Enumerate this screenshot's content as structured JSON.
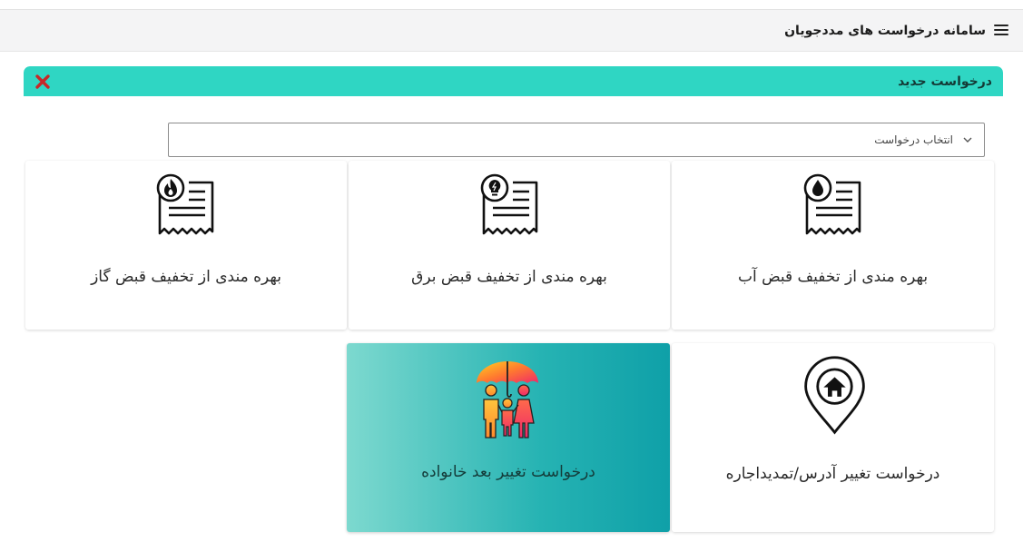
{
  "header": {
    "title": "سامانه درخواست های مددجویان",
    "menu_icon": "hamburger-menu-icon"
  },
  "panel": {
    "title": "درخواست جدید",
    "close_icon": "close-icon",
    "close_color": "#c62828",
    "header_color": "#2fd6c3"
  },
  "select": {
    "label": "انتخاب درخواست",
    "icon": "chevron-down-icon"
  },
  "cards": [
    {
      "label": "بهره مندی از تخفیف قبض آب",
      "icon": "water-bill-icon"
    },
    {
      "label": "بهره مندی از تخفیف قبض برق",
      "icon": "electricity-bill-icon"
    },
    {
      "label": "بهره مندی از تخفیف قبض گاز",
      "icon": "gas-bill-icon"
    },
    {
      "label": "درخواست تغییر آدرس/تمدیداجاره",
      "icon": "home-location-icon"
    },
    {
      "label": "درخواست تغییر بعد خانواده",
      "icon": "family-umbrella-icon",
      "selected": true
    }
  ]
}
